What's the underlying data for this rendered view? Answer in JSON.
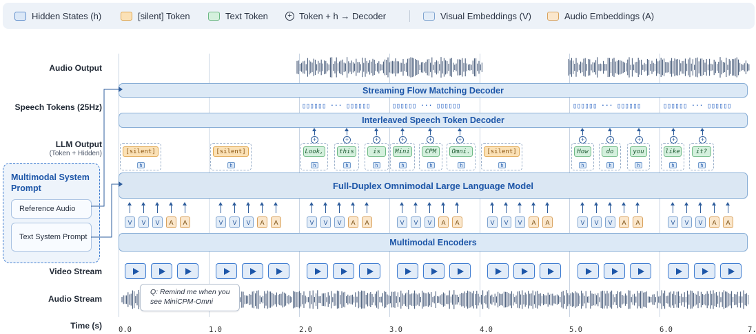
{
  "legend": {
    "items": [
      {
        "label": "Hidden States (h)",
        "swatch_fill": "#dbe8f7",
        "swatch_border": "#5f8ecb"
      },
      {
        "label": "[silent] Token",
        "swatch_fill": "#fbe1b6",
        "swatch_border": "#e0a64d"
      },
      {
        "label": "Text Token",
        "swatch_fill": "#d4f0dd",
        "swatch_border": "#6cb883"
      },
      {
        "label": "Token + h → Decoder",
        "icon": "circle-plus-icon"
      },
      {
        "label": "Visual Embeddings (V)",
        "swatch_fill": "#e3edf8",
        "swatch_border": "#7ea3cf"
      },
      {
        "label": "Audio Embeddings (A)",
        "swatch_fill": "#fbe7cc",
        "swatch_border": "#d8a25e"
      }
    ]
  },
  "rows": {
    "audio_output": "Audio Output",
    "speech_tokens": "Speech Tokens (25Hz)",
    "llm_output": "LLM Output",
    "llm_output_sub": "(Token + Hidden)",
    "video_stream": "Video Stream",
    "audio_stream": "Audio Stream",
    "time": "Time (s)"
  },
  "bands": {
    "flow_decoder": "Streaming Flow Matching Decoder",
    "speech_token_decoder": "Interleaved Speech Token Decoder",
    "llm": "Full-Duplex Omnimodal Large Language Model",
    "encoders": "Multimodal Encoders"
  },
  "system_prompt": {
    "title": "Multimodal System Prompt",
    "reference_audio": "Reference Audio",
    "text_system_prompt": "Text System Prompt"
  },
  "speech_token_groups": [
    "▯▯▯▯▯▯ ··· ▯▯▯▯▯▯",
    "▯▯▯▯▯▯ ··· ▯▯▯▯▯▯",
    "▯▯▯▯▯▯ ··· ▯▯▯▯▯▯",
    "▯▯▯▯▯▯ ··· ▯▯▯▯▯▯"
  ],
  "llm_tokens": [
    {
      "text": "[silent]",
      "kind": "silent"
    },
    {
      "text": "[silent]",
      "kind": "silent"
    },
    {
      "text": "Look,",
      "kind": "text"
    },
    {
      "text": "this",
      "kind": "text"
    },
    {
      "text": "is",
      "kind": "text"
    },
    {
      "text": "Mini",
      "kind": "text"
    },
    {
      "text": "CPM",
      "kind": "text"
    },
    {
      "text": "Omni.",
      "kind": "text"
    },
    {
      "text": "[silent]",
      "kind": "silent"
    },
    {
      "text": "How",
      "kind": "text"
    },
    {
      "text": "do",
      "kind": "text"
    },
    {
      "text": "you",
      "kind": "text"
    },
    {
      "text": "like",
      "kind": "text"
    },
    {
      "text": "it?",
      "kind": "text"
    }
  ],
  "hidden_label": "h",
  "plus_symbol": "+",
  "embedding_labels": {
    "visual": "V",
    "audio": "A"
  },
  "embedding_pattern": [
    "V",
    "V",
    "V",
    "A",
    "A"
  ],
  "question_bubble": "Q: Remind me when you see MiniCPM-Omni",
  "time_ticks": [
    "0.0",
    "1.0",
    "2.0",
    "3.0",
    "4.0",
    "5.0",
    "6.0",
    "7."
  ],
  "colors": {
    "accent": "#1d56a8",
    "band_fill": "#dce9f6",
    "wave": "#4a5e7c"
  }
}
